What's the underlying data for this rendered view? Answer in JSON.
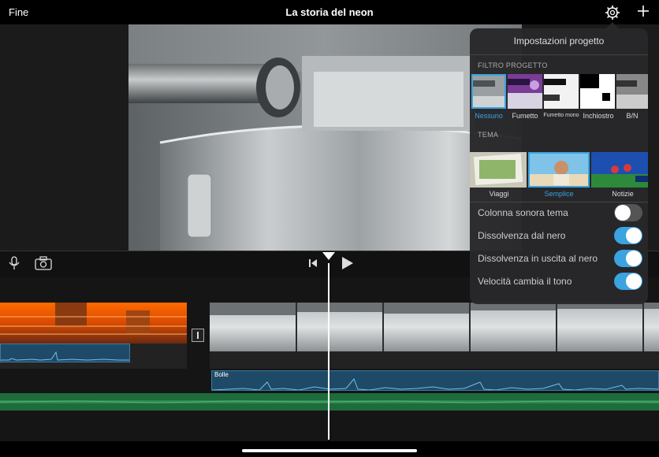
{
  "header": {
    "done_label": "Fine",
    "project_title": "La storia del neon",
    "settings_icon": "gear-icon",
    "add_icon": "plus-icon"
  },
  "controls": {
    "mic_icon": "microphone-icon",
    "camera_icon": "camera-icon",
    "skip_back_icon": "skip-to-start-icon",
    "play_icon": "play-icon"
  },
  "timeline": {
    "sound_effect_label": "Bolle"
  },
  "settings_popover": {
    "title": "Impostazioni progetto",
    "filter_section": "FILTRO PROGETTO",
    "filters": [
      {
        "label": "Nessuno",
        "selected": true
      },
      {
        "label": "Fumetto",
        "selected": false
      },
      {
        "label": "Fumetto mono",
        "selected": false
      },
      {
        "label": "Inchiostro",
        "selected": false
      },
      {
        "label": "B/N",
        "selected": false
      }
    ],
    "theme_section": "TEMA",
    "themes": [
      {
        "label": "Viaggi",
        "selected": false
      },
      {
        "label": "Semplice",
        "selected": true
      },
      {
        "label": "Notizie",
        "selected": false
      }
    ],
    "toggles": [
      {
        "label": "Colonna sonora tema",
        "on": false
      },
      {
        "label": "Dissolvenza dal nero",
        "on": true
      },
      {
        "label": "Dissolvenza in uscita al nero",
        "on": true
      },
      {
        "label": "Velocità cambia il tono",
        "on": true
      }
    ]
  },
  "colors": {
    "accent": "#3aa3e0",
    "toggle_on": "#3aa3e0",
    "toggle_off": "#555555",
    "audio_clip": "#1f4a67",
    "music_track": "#1e6b3b"
  }
}
